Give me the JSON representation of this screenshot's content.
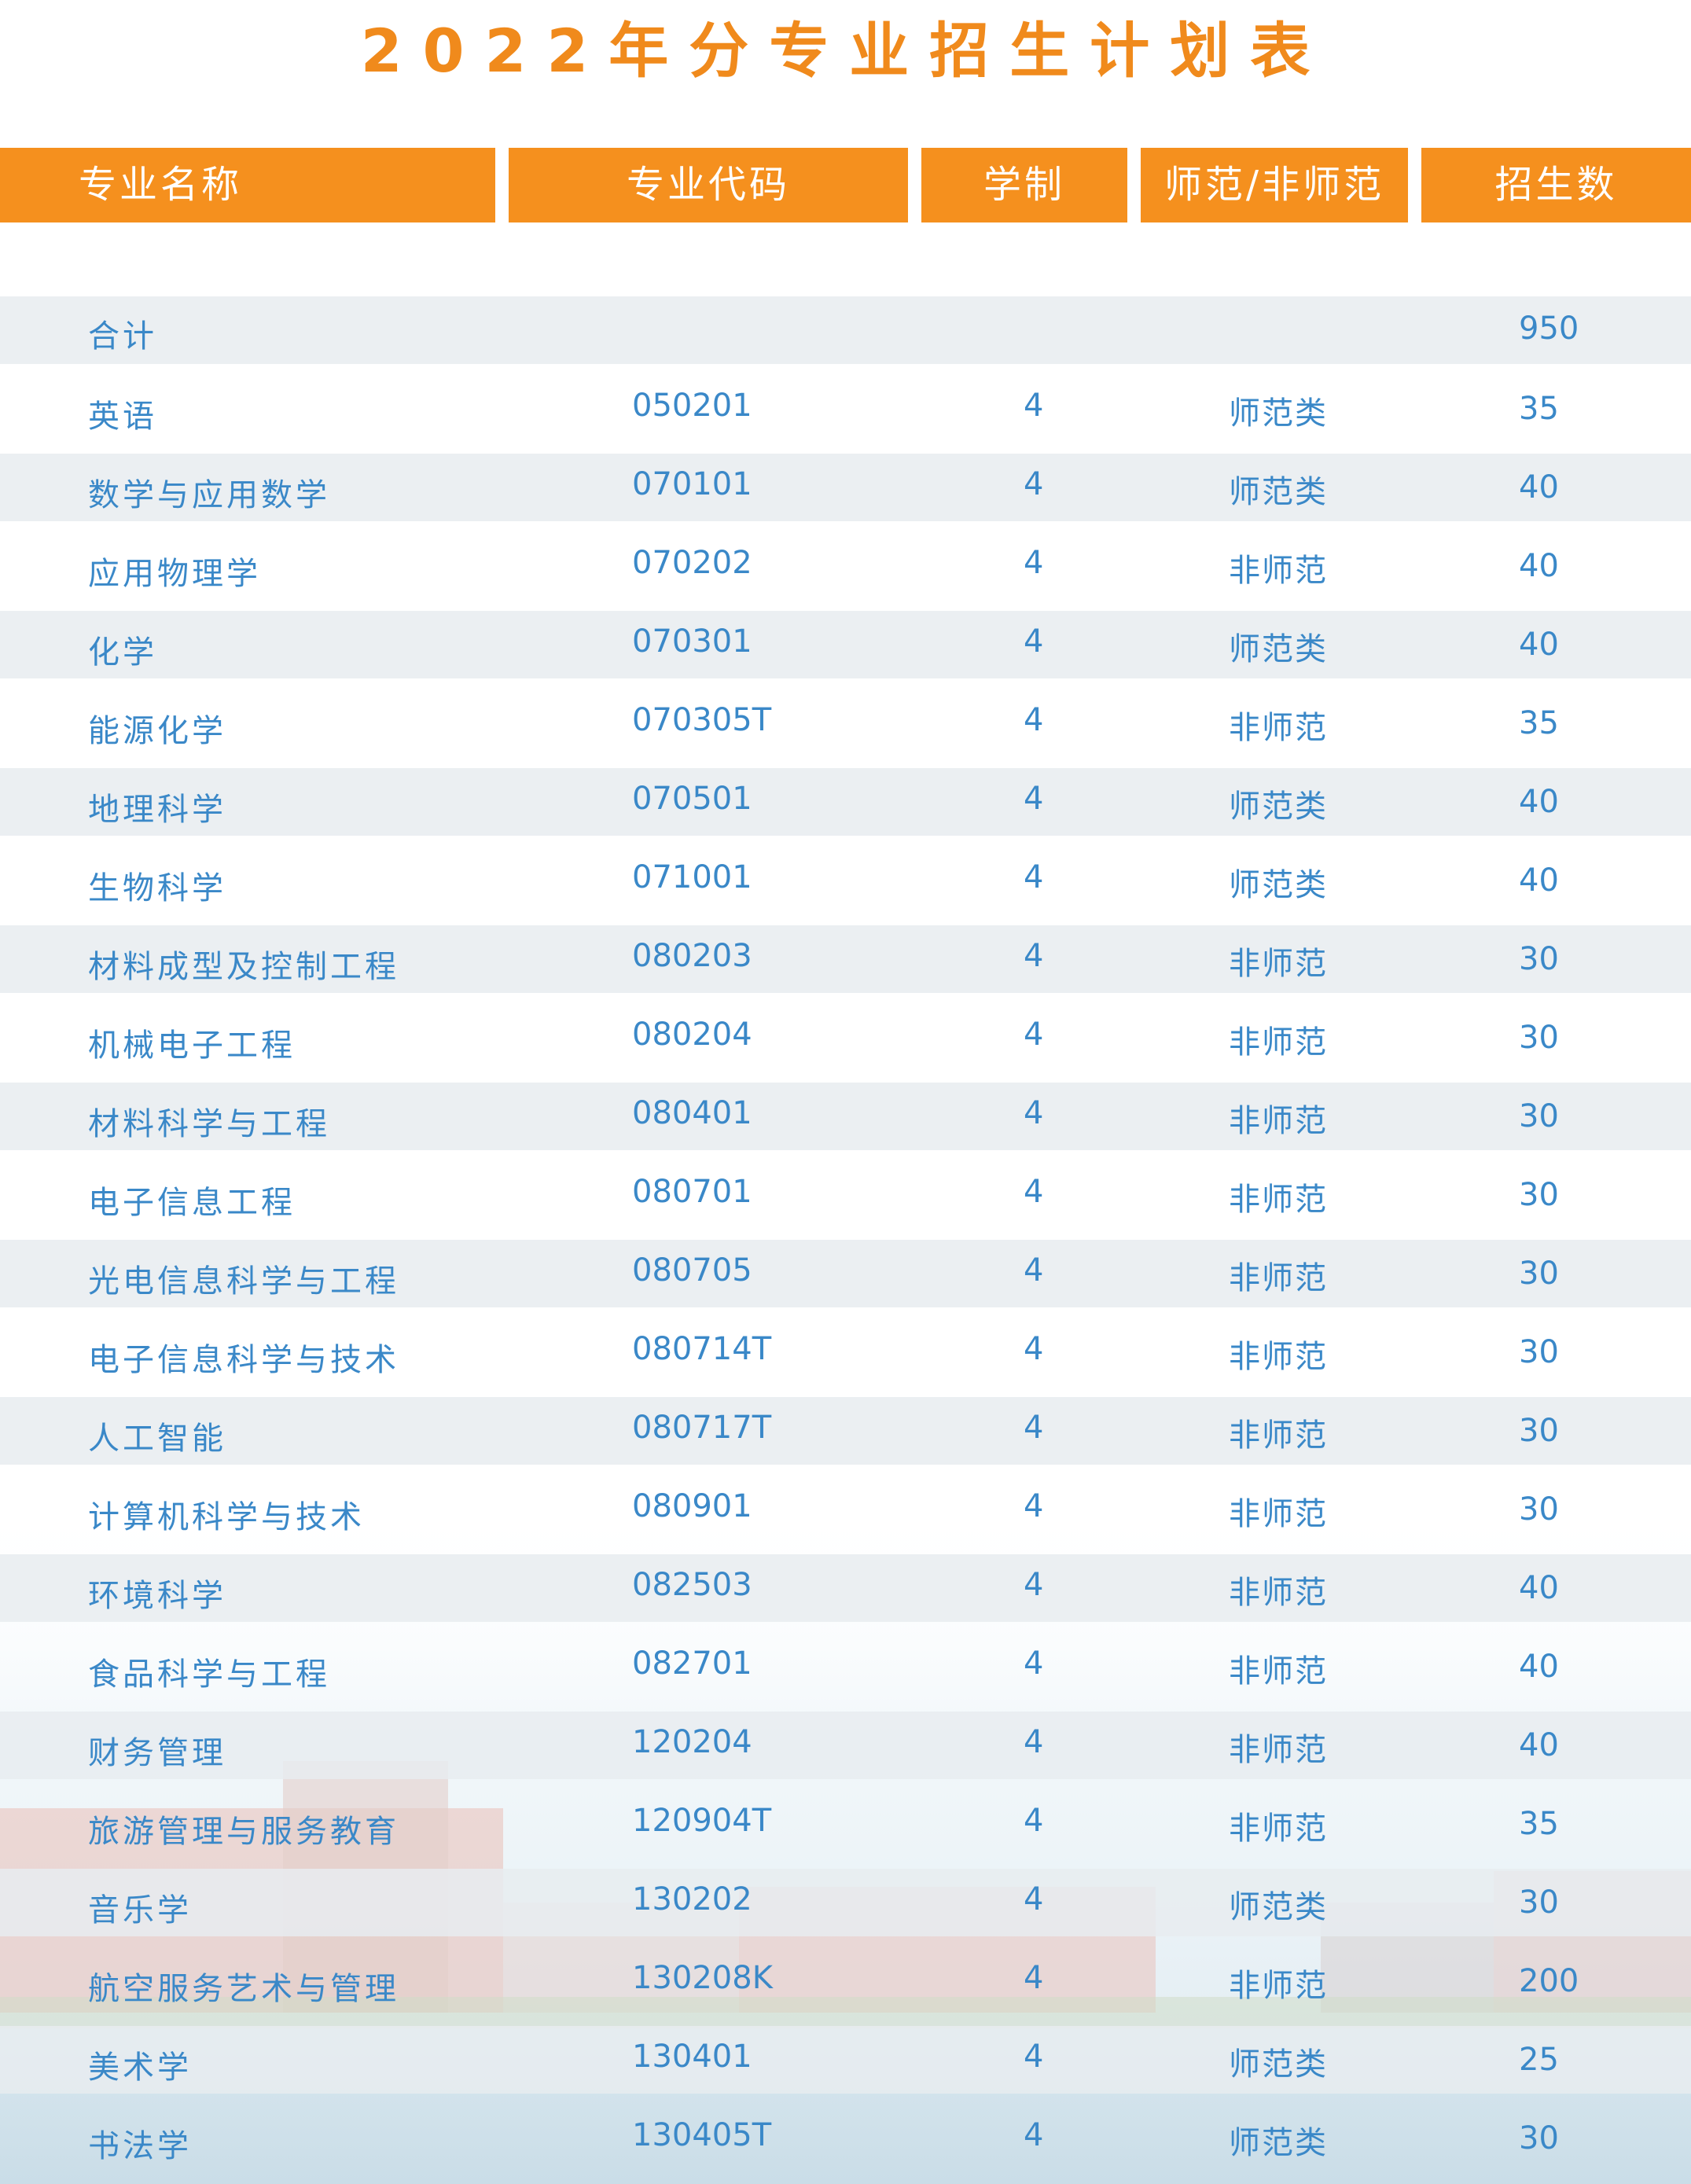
{
  "title": "2022年分专业招生计划表",
  "headers": [
    "专业名称",
    "专业代码",
    "学制",
    "师范/非师范",
    "招生数"
  ],
  "total": {
    "name": "合计",
    "count": "950"
  },
  "rows": [
    {
      "name": "英语",
      "code": "050201",
      "duration": "4",
      "type": "师范类",
      "count": "35"
    },
    {
      "name": "数学与应用数学",
      "code": "070101",
      "duration": "4",
      "type": "师范类",
      "count": "40"
    },
    {
      "name": "应用物理学",
      "code": "070202",
      "duration": "4",
      "type": "非师范",
      "count": "40"
    },
    {
      "name": "化学",
      "code": "070301",
      "duration": "4",
      "type": "师范类",
      "count": "40"
    },
    {
      "name": "能源化学",
      "code": "070305T",
      "duration": "4",
      "type": "非师范",
      "count": "35"
    },
    {
      "name": "地理科学",
      "code": "070501",
      "duration": "4",
      "type": "师范类",
      "count": "40"
    },
    {
      "name": "生物科学",
      "code": "071001",
      "duration": "4",
      "type": "师范类",
      "count": "40"
    },
    {
      "name": "材料成型及控制工程",
      "code": "080203",
      "duration": "4",
      "type": "非师范",
      "count": "30"
    },
    {
      "name": "机械电子工程",
      "code": "080204",
      "duration": "4",
      "type": "非师范",
      "count": "30"
    },
    {
      "name": "材料科学与工程",
      "code": "080401",
      "duration": "4",
      "type": "非师范",
      "count": "30"
    },
    {
      "name": "电子信息工程",
      "code": "080701",
      "duration": "4",
      "type": "非师范",
      "count": "30"
    },
    {
      "name": "光电信息科学与工程",
      "code": "080705",
      "duration": "4",
      "type": "非师范",
      "count": "30"
    },
    {
      "name": "电子信息科学与技术",
      "code": "080714T",
      "duration": "4",
      "type": "非师范",
      "count": "30"
    },
    {
      "name": "人工智能",
      "code": "080717T",
      "duration": "4",
      "type": "非师范",
      "count": "30"
    },
    {
      "name": "计算机科学与技术",
      "code": "080901",
      "duration": "4",
      "type": "非师范",
      "count": "30"
    },
    {
      "name": "环境科学",
      "code": "082503",
      "duration": "4",
      "type": "非师范",
      "count": "40"
    },
    {
      "name": "食品科学与工程",
      "code": "082701",
      "duration": "4",
      "type": "非师范",
      "count": "40"
    },
    {
      "name": "财务管理",
      "code": "120204",
      "duration": "4",
      "type": "非师范",
      "count": "40"
    },
    {
      "name": "旅游管理与服务教育",
      "code": "120904T",
      "duration": "4",
      "type": "非师范",
      "count": "35"
    },
    {
      "name": "音乐学",
      "code": "130202",
      "duration": "4",
      "type": "师范类",
      "count": "30"
    },
    {
      "name": "航空服务艺术与管理",
      "code": "130208K",
      "duration": "4",
      "type": "非师范",
      "count": "200"
    },
    {
      "name": "美术学",
      "code": "130401",
      "duration": "4",
      "type": "师范类",
      "count": "25"
    },
    {
      "name": "书法学",
      "code": "130405T",
      "duration": "4",
      "type": "师范类",
      "count": "30"
    }
  ]
}
